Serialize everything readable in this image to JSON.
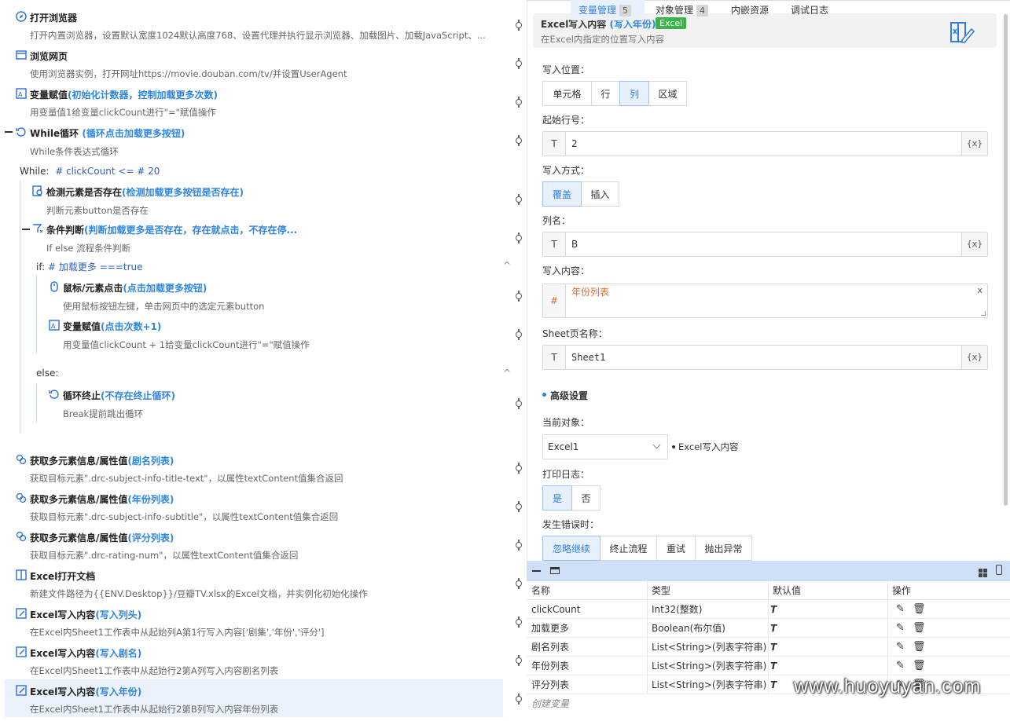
{
  "flow": {
    "steps": [
      {
        "title": "打开浏览器",
        "alias": "",
        "desc": "打开内置浏览器，设置默认宽度1024默认高度768、设置代理并执行显示浏览器、加载图片、加载JavaScript、..."
      },
      {
        "title": "浏览网页",
        "alias": "",
        "desc": "使用浏览器实例，打开网址https://movie.douban.com/tv/并设置UserAgent"
      },
      {
        "title": "变量赋值",
        "alias": "(初始化计数器，控制加载更多次数)",
        "desc": "用变量值1给变量clickCount进行\"=\"赋值操作"
      },
      {
        "title": "While循环",
        "alias": "(循环点击加载更多按钮)",
        "desc": "While条件表达式循环"
      },
      {
        "title": "检测元素是否存在",
        "alias": "(检测加载更多按钮是否存在)",
        "desc": "判断元素button是否存在"
      },
      {
        "title": "条件判断",
        "alias": "(判断加载更多是否存在，存在就点击，不存在停...",
        "desc": "If else 流程条件判断"
      },
      {
        "title": "鼠标/元素点击",
        "alias": "(点击加载更多按钮)",
        "desc": "使用鼠标按钮左键，单击网页中的选定元素button"
      },
      {
        "title": "变量赋值",
        "alias": "(点击次数+1)",
        "desc": "用变量值clickCount + 1给变量clickCount进行\"=\"赋值操作"
      },
      {
        "title": "循环终止",
        "alias": "(不存在终止循环)",
        "desc": "Break提前跳出循环"
      },
      {
        "title": "获取多元素信息/属性值",
        "alias": "(剧名列表)",
        "desc": "获取目标元素\".drc-subject-info-title-text\"，以属性textContent值集合返回"
      },
      {
        "title": "获取多元素信息/属性值",
        "alias": "(年份列表)",
        "desc": "获取目标元素\".drc-subject-info-subtitle\"，以属性textContent值集合返回"
      },
      {
        "title": "获取多元素信息/属性值",
        "alias": "(评分列表)",
        "desc": "获取目标元素\".drc-rating-num\"，以属性textContent值集合返回"
      },
      {
        "title": "Excel打开文档",
        "alias": "",
        "desc": "新建文件路径为{{ENV.Desktop}}/豆瓣TV.xlsx的Excel文档，并实例化初始化操作"
      },
      {
        "title": "Excel写入内容",
        "alias": "(写入列头)",
        "desc": "在Excel内Sheet1工作表中从起始列A第1行写入内容['剧集','年份','评分']"
      },
      {
        "title": "Excel写入内容",
        "alias": "(写入剧名)",
        "desc": "在Excel内Sheet1工作表中从起始行2第A列写入内容剧名列表"
      },
      {
        "title": "Excel写入内容",
        "alias": "(写入年份)",
        "desc": "在Excel内Sheet1工作表中从起始行2第B列写入内容年份列表"
      }
    ],
    "while_label": "While:",
    "while_expr": "# clickCount <= # 20",
    "if_label": "if:",
    "if_expr": "# 加载更多 ===true",
    "else_label": "else:",
    "collapse_glyph": "^"
  },
  "props": {
    "header_title": "Excel写入内容",
    "header_alias": "(写入年份)",
    "header_badge": "Excel",
    "header_desc": "在Excel内指定的位置写入内容",
    "write_pos_label": "写入位置：",
    "write_pos_opts": [
      "单元格",
      "行",
      "列",
      "区域"
    ],
    "start_row_label": "起始行号：",
    "start_row_value": "2",
    "write_mode_label": "写入方式：",
    "write_mode_opts": [
      "覆盖",
      "插入"
    ],
    "col_name_label": "列名：",
    "col_name_value": "B",
    "content_label": "写入内容：",
    "content_value": "年份列表",
    "sheet_label": "Sheet页名称：",
    "sheet_value": "Sheet1",
    "type_T": "T",
    "type_hash": "#",
    "var_btn": "{x}",
    "clear": "x",
    "advanced": "高级设置",
    "cur_obj_label": "当前对象：",
    "cur_obj_value": "Excel1",
    "cur_obj_hint": "Excel写入内容",
    "log_label": "打印日志：",
    "log_opts": [
      "是",
      "否"
    ],
    "err_label": "发生错误时：",
    "err_opts": [
      "忽略继续",
      "终止流程",
      "重试",
      "抛出异常"
    ]
  },
  "bottom": {
    "tabs": [
      {
        "label": "变量管理",
        "count": "5"
      },
      {
        "label": "对象管理",
        "count": "4"
      },
      {
        "label": "内嵌资源",
        "count": ""
      },
      {
        "label": "调试日志",
        "count": ""
      }
    ],
    "headers": [
      "名称",
      "类型",
      "默认值",
      "操作"
    ],
    "rows": [
      {
        "name": "clickCount",
        "type": "Int32(整数)",
        "def": "T"
      },
      {
        "name": "加载更多",
        "type": "Boolean(布尔值)",
        "def": "T"
      },
      {
        "name": "剧名列表",
        "type": "List<String>(列表字符串)",
        "def": "T"
      },
      {
        "name": "年份列表",
        "type": "List<String>(列表字符串)",
        "def": "T"
      },
      {
        "name": "评分列表",
        "type": "List<String>(列表字符串)",
        "def": "T"
      }
    ],
    "create": "创建变量"
  },
  "watermark": "www.huoyuyan.com"
}
